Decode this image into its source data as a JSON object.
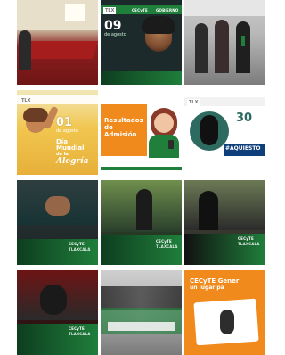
{
  "grid": {
    "tiles": [
      {
        "kind": "photo-meeting",
        "texts": {}
      },
      {
        "kind": "poster",
        "texts": {
          "header_logo": "TLX",
          "header_brand": "CECyTE",
          "header_brand2": "GOBIERNO",
          "date_num": "09",
          "date_word": "de agosto"
        }
      },
      {
        "kind": "photo-ceremony",
        "texts": {}
      },
      {
        "kind": "poster",
        "texts": {
          "header_logo": "TLX",
          "date_num": "01",
          "date_word": "de agosto",
          "title": "Día Mundial",
          "title2": "de la",
          "script": "Alegría"
        }
      },
      {
        "kind": "poster",
        "texts": {
          "title": "Resultados",
          "subtitle": "de Admisión"
        }
      },
      {
        "kind": "poster",
        "texts": {
          "header_logo": "TLX",
          "big_num": "30",
          "hashtag": "#AQUIESTO"
        }
      },
      {
        "kind": "poster",
        "texts": {
          "cecyte": "CECyTE",
          "sub": "TLAXCALA"
        }
      },
      {
        "kind": "poster",
        "texts": {
          "cecyte": "CECyTE",
          "sub": "TLAXCALA"
        }
      },
      {
        "kind": "poster",
        "texts": {
          "cecyte": "CECyTE",
          "sub": "TLAXCALA"
        }
      },
      {
        "kind": "poster",
        "texts": {
          "cecyte": "CECyTE",
          "sub": "TLAXCALA"
        }
      },
      {
        "kind": "photo-graduation",
        "texts": {}
      },
      {
        "kind": "poster",
        "texts": {
          "title": "CECyTE Gener",
          "subtitle": "un lugar pa"
        }
      }
    ]
  }
}
